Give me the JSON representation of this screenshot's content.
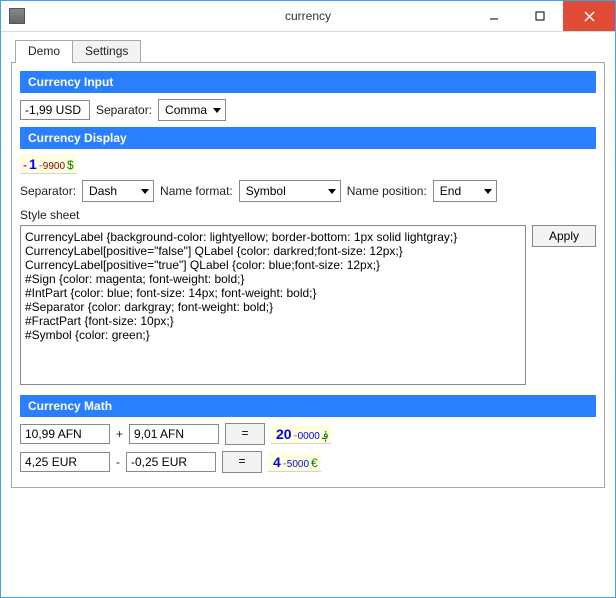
{
  "window": {
    "title": "currency"
  },
  "tabs": {
    "demo": "Demo",
    "settings": "Settings"
  },
  "sections": {
    "input": "Currency Input",
    "display": "Currency Display",
    "math": "Currency Math"
  },
  "currencyInput": {
    "value": "-1,99 USD",
    "separatorLabel": "Separator:",
    "separatorValue": "Comma"
  },
  "displaySample": {
    "sign": "-",
    "int": "1",
    "sep": "-",
    "frac": "9900",
    "symbol": "$"
  },
  "displayOptions": {
    "separatorLabel": "Separator:",
    "separatorValue": "Dash",
    "nameFormatLabel": "Name format:",
    "nameFormatValue": "Symbol",
    "namePositionLabel": "Name position:",
    "namePositionValue": "End"
  },
  "stylesheet": {
    "label": "Style sheet",
    "value": "CurrencyLabel {background-color: lightyellow; border-bottom: 1px solid lightgray;}\nCurrencyLabel[positive=\"false\"] QLabel {color: darkred;font-size: 12px;}\nCurrencyLabel[positive=\"true\"] QLabel {color: blue;font-size: 12px;}\n#Sign {color: magenta; font-weight: bold;}\n#IntPart {color: blue; font-size: 14px; font-weight: bold;}\n#Separator {color: darkgray; font-weight: bold;}\n#FractPart {font-size: 10px;}\n#Symbol {color: green;}",
    "apply": "Apply"
  },
  "math": {
    "row1": {
      "a": "10,99 AFN",
      "op": "+",
      "b": "9,01 AFN",
      "eq": "=",
      "result": {
        "int": "20",
        "sep": "-",
        "frac": "0000",
        "symbol": "؋"
      }
    },
    "row2": {
      "a": "4,25 EUR",
      "op": "-",
      "b": "-0,25 EUR",
      "eq": "=",
      "result": {
        "int": "4",
        "sep": "-",
        "frac": "5000",
        "symbol": "€"
      }
    }
  }
}
